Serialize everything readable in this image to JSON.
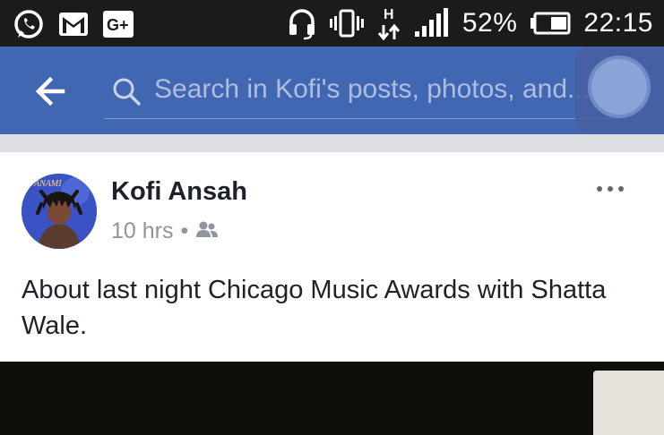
{
  "status_bar": {
    "battery": "52%",
    "time": "22:15",
    "left_icons": [
      "whatsapp-icon",
      "gmail-icon",
      "google-plus-icon"
    ],
    "right_icons": [
      "headset-icon",
      "vibrate-icon",
      "network-h-icon",
      "signal-icon",
      "battery-icon"
    ],
    "network_letter": "H"
  },
  "header": {
    "search_placeholder": "Search in Kofi's posts, photos, and..."
  },
  "post": {
    "author": "Kofi Ansah",
    "timestamp": "10 hrs",
    "separator": "•",
    "audience_icon": "friends-icon",
    "text": "About last night Chicago Music Awards with Shatta Wale.",
    "avatar_text": "ANAMI"
  },
  "colors": {
    "status_bar": "#1b1b1b",
    "header": "#4267b2",
    "divider": "#dddfe2",
    "author": "#1d2129",
    "meta": "#90949c"
  }
}
